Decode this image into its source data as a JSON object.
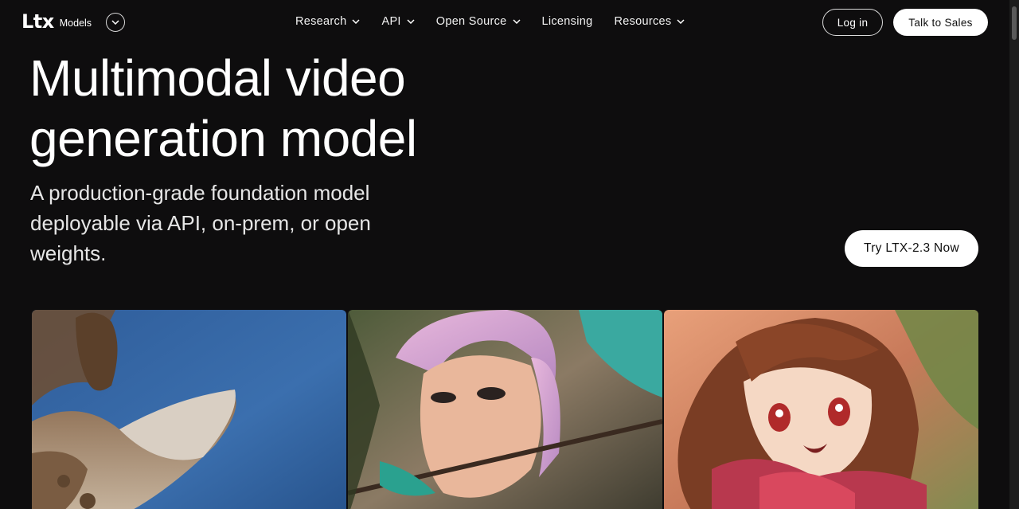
{
  "brand": {
    "logo": "Ltx",
    "sub": "Models"
  },
  "nav": {
    "items": [
      {
        "label": "Research",
        "dropdown": true
      },
      {
        "label": "API",
        "dropdown": true
      },
      {
        "label": "Open Source",
        "dropdown": true
      },
      {
        "label": "Licensing",
        "dropdown": false
      },
      {
        "label": "Resources",
        "dropdown": true
      }
    ],
    "login": "Log in",
    "sales": "Talk to Sales"
  },
  "hero": {
    "title": "Multimodal video generation model",
    "subtitle": "A production-grade foundation model deployable via API, on-prem, or open weights.",
    "cta": "Try LTX-2.3 Now"
  },
  "gallery": [
    "giraffe-video",
    "archer-video",
    "anime-video"
  ],
  "colors": {
    "background": "#0e0d0e",
    "text": "#ffffff",
    "button": "#ffffff"
  }
}
